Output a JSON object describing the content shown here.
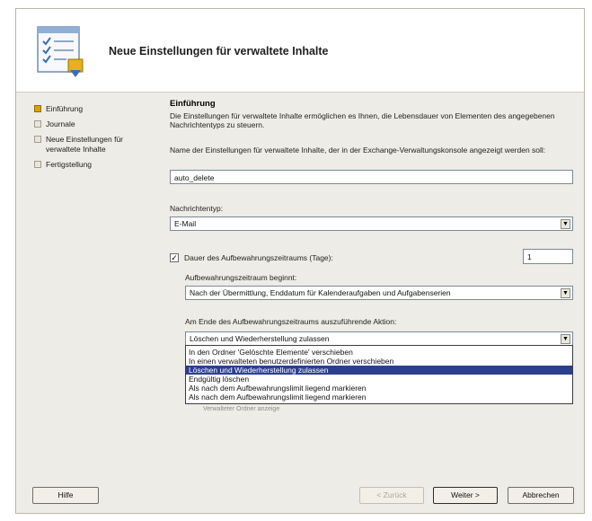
{
  "header": {
    "title": "Neue Einstellungen für verwaltete Inhalte",
    "icon": "checklist-icon"
  },
  "steps": [
    {
      "label": "Einführung",
      "active": true
    },
    {
      "label": "Journale",
      "active": false
    },
    {
      "label": "Neue Einstellungen für verwaltete Inhalte",
      "active": false
    },
    {
      "label": "Fertigstellung",
      "active": false
    }
  ],
  "section": {
    "title": "Einführung",
    "description": "Die Einstellungen für verwaltete Inhalte ermöglichen es Ihnen, die Lebensdauer von Elementen des angegebenen Nachrichtentyps zu steuern."
  },
  "name_field": {
    "label": "Name der Einstellungen für verwaltete Inhalte, der in der Exchange-Verwaltungskonsole angezeigt werden soll:",
    "value": "auto_delete"
  },
  "message_type": {
    "label": "Nachrichtentyp:",
    "value": "E-Mail"
  },
  "retention": {
    "checkbox_label": "Dauer des Aufbewahrungszeitraums (Tage):",
    "checked": true,
    "days_value": "1",
    "start_label": "Aufbewahrungszeitraum beginnt:",
    "start_value": "Nach der Übermittlung, Enddatum für Kalenderaufgaben und Aufgabenserien",
    "action_label": "Am Ende des Aufbewahrungszeitraums auszuführende Aktion:",
    "action_value": "Löschen und Wiederherstellung zulassen",
    "action_options": [
      "In den Ordner 'Gelöschte Elemente' verschieben",
      "In einen verwalteten benutzerdefinierten Ordner verschieben",
      "Löschen und Wiederherstellung zulassen",
      "Endgültig löschen",
      "Als nach dem Aufbewahrungslimit liegend markieren",
      "Als nach dem Aufbewahrungslimit liegend markieren"
    ],
    "selected_index": 2,
    "hidden_field_text": "Verwalteter Ordner anzeige"
  },
  "buttons": {
    "help": "Hilfe",
    "back": "< Zurück",
    "next": "Weiter >",
    "cancel": "Abbrechen"
  },
  "colors": {
    "selection": "#2c3f8f",
    "active_step": "#d9a400"
  }
}
